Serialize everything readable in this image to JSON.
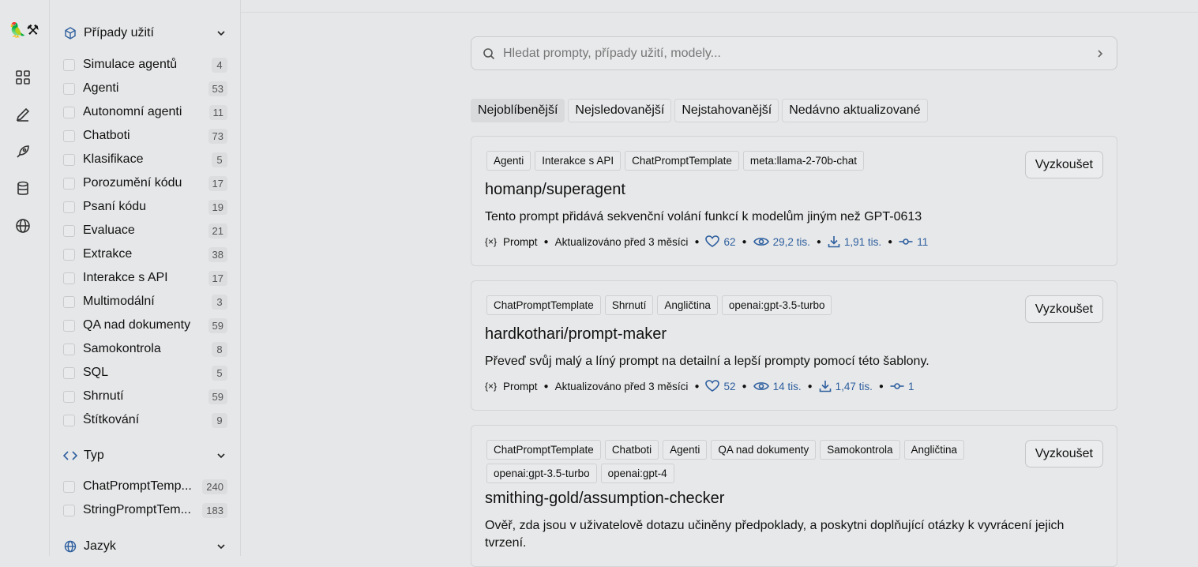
{
  "sidebar": {
    "use_cases": {
      "title": "Případy užití",
      "items": [
        {
          "label": "Simulace agentů",
          "count": "4"
        },
        {
          "label": "Agenti",
          "count": "53"
        },
        {
          "label": "Autonomní agenti",
          "count": "11"
        },
        {
          "label": "Chatboti",
          "count": "73"
        },
        {
          "label": "Klasifikace",
          "count": "5"
        },
        {
          "label": "Porozumění kódu",
          "count": "17"
        },
        {
          "label": "Psaní kódu",
          "count": "19"
        },
        {
          "label": "Evaluace",
          "count": "21"
        },
        {
          "label": "Extrakce",
          "count": "38"
        },
        {
          "label": "Interakce s API",
          "count": "17"
        },
        {
          "label": "Multimodální",
          "count": "3"
        },
        {
          "label": "QA nad dokumenty",
          "count": "59"
        },
        {
          "label": "Samokontrola",
          "count": "8"
        },
        {
          "label": "SQL",
          "count": "5"
        },
        {
          "label": "Shrnutí",
          "count": "59"
        },
        {
          "label": "Štítkování",
          "count": "9"
        }
      ]
    },
    "type": {
      "title": "Typ",
      "items": [
        {
          "label": "ChatPromptTemp...",
          "count": "240"
        },
        {
          "label": "StringPromptTem...",
          "count": "183"
        }
      ]
    },
    "language": {
      "title": "Jazyk"
    }
  },
  "search": {
    "placeholder": "Hledat prompty, případy užití, modely..."
  },
  "tabs": [
    "Nejoblíbenější",
    "Nejsledovanější",
    "Nejstahovanější",
    "Nedávno aktualizované"
  ],
  "cards": [
    {
      "tags": [
        "Agenti",
        "Interakce s API",
        "ChatPromptTemplate",
        "meta:llama-2-70b-chat"
      ],
      "title": "homanp/superagent",
      "description": "Tento prompt přidává sekvenční volání funkcí k modelům jiným než GPT-0613",
      "meta": {
        "type": "Prompt",
        "updated": "Aktualizováno před 3 měsíci",
        "likes": "62",
        "views": "29,2 tis.",
        "downloads": "1,91 tis.",
        "commits": "11"
      },
      "button": "Vyzkoušet"
    },
    {
      "tags": [
        "ChatPromptTemplate",
        "Shrnutí",
        "Angličtina",
        "openai:gpt-3.5-turbo"
      ],
      "title": "hardkothari/prompt-maker",
      "description": "Převeď svůj malý a líný prompt na detailní a lepší prompty pomocí této šablony.",
      "meta": {
        "type": "Prompt",
        "updated": "Aktualizováno před 3 měsíci",
        "likes": "52",
        "views": "14 tis.",
        "downloads": "1,47 tis.",
        "commits": "1"
      },
      "button": "Vyzkoušet"
    },
    {
      "tags": [
        "ChatPromptTemplate",
        "Chatboti",
        "Agenti",
        "QA nad dokumenty",
        "Samokontrola",
        "Angličtina",
        "openai:gpt-3.5-turbo",
        "openai:gpt-4"
      ],
      "title": "smithing-gold/assumption-checker",
      "description": "Ověř, zda jsou v uživatelově dotazu učiněny předpoklady, a poskytni doplňující otázky k vyvrácení jejich tvrzení.",
      "button": "Vyzkoušet"
    }
  ],
  "colors": {
    "accent": "#2e5f9f",
    "background": "#e6e7e8"
  }
}
